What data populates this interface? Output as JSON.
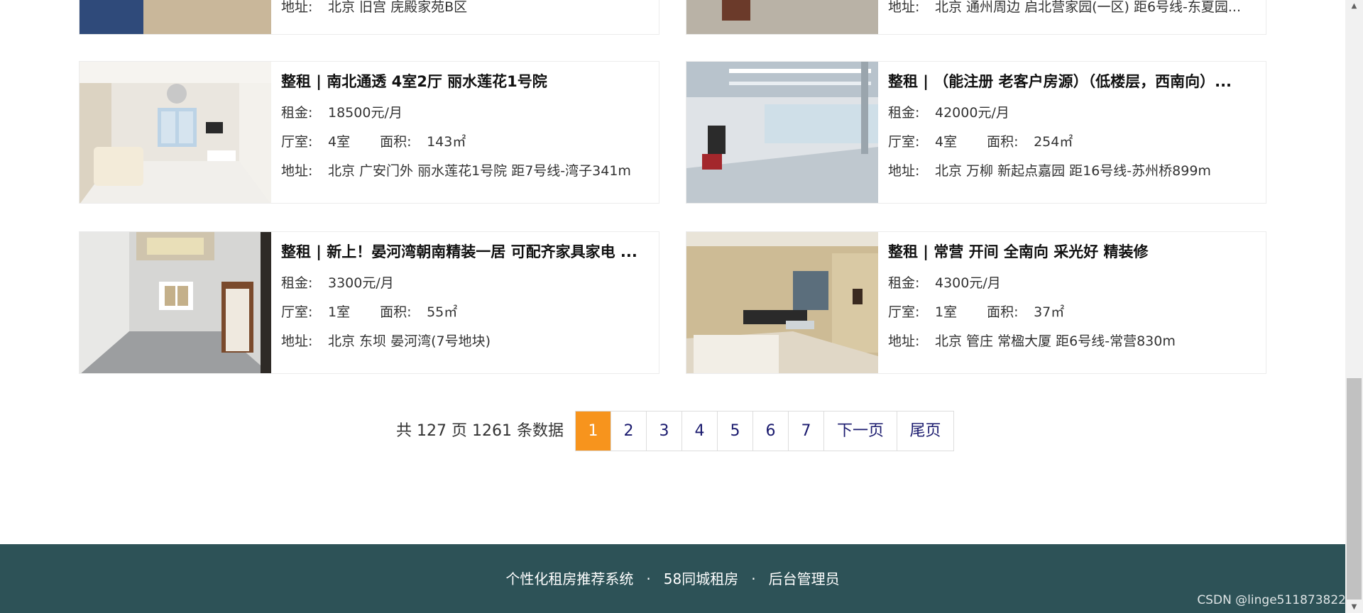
{
  "listings": [
    {
      "title": "",
      "rent_label": "",
      "rent": "",
      "rooms_label": "",
      "rooms": "",
      "area_label": "",
      "area": "",
      "addr_label": "地址:",
      "address": "北京 旧宫 庑殿家苑B区"
    },
    {
      "title": "",
      "rent_label": "",
      "rent": "",
      "rooms_label": "",
      "rooms": "",
      "area_label": "",
      "area": "",
      "addr_label": "地址:",
      "address": "北京 通州周边 启北营家园(一区) 距6号线-东夏园..."
    },
    {
      "title": "整租 | 南北通透 4室2厅 丽水莲花1号院",
      "rent_label": "租金:",
      "rent": "18500元/月",
      "rooms_label": "厅室:",
      "rooms": "4室",
      "area_label": "面积:",
      "area": "143㎡",
      "addr_label": "地址:",
      "address": "北京 广安门外 丽水莲花1号院 距7号线-湾子341m"
    },
    {
      "title": "整租 | （能注册 老客户房源）（低楼层，西南向）...",
      "rent_label": "租金:",
      "rent": "42000元/月",
      "rooms_label": "厅室:",
      "rooms": "4室",
      "area_label": "面积:",
      "area": "254㎡",
      "addr_label": "地址:",
      "address": "北京 万柳 新起点嘉园 距16号线-苏州桥899m"
    },
    {
      "title": "整租 | 新上！晏河湾朝南精装一居 可配齐家具家电 ...",
      "rent_label": "租金:",
      "rent": "3300元/月",
      "rooms_label": "厅室:",
      "rooms": "1室",
      "area_label": "面积:",
      "area": "55㎡",
      "addr_label": "地址:",
      "address": "北京 东坝 晏河湾(7号地块)"
    },
    {
      "title": "整租 | 常营 开间 全南向 采光好 精装修",
      "rent_label": "租金:",
      "rent": "4300元/月",
      "rooms_label": "厅室:",
      "rooms": "1室",
      "area_label": "面积:",
      "area": "37㎡",
      "addr_label": "地址:",
      "address": "北京 管庄 常楹大厦 距6号线-常营830m"
    }
  ],
  "pagination": {
    "total_text": "共 127 页 1261 条数据",
    "pages": [
      "1",
      "2",
      "3",
      "4",
      "5",
      "6",
      "7"
    ],
    "current": "1",
    "next_label": "下一页",
    "last_label": "尾页"
  },
  "footer": {
    "links": [
      "个性化租房推荐系统",
      "58同城租房",
      "后台管理员"
    ],
    "separator": "·"
  },
  "watermark": "CSDN @linge511873822",
  "colors": {
    "accent": "#f7941d",
    "footer_bg": "#2d5257",
    "page_link": "#1a1a6e"
  }
}
